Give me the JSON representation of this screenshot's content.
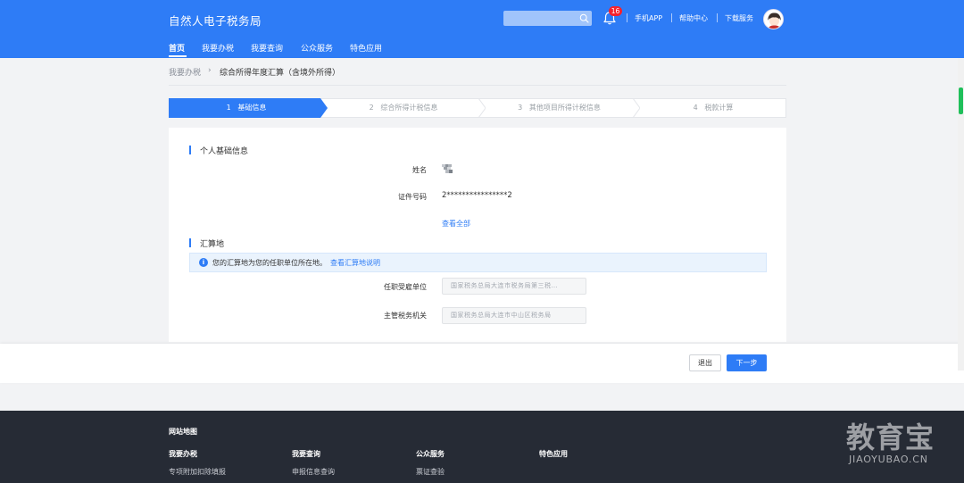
{
  "header": {
    "site_title": "自然人电子税务局",
    "search_placeholder": "",
    "notification_count": "16",
    "links": [
      "手机APP",
      "帮助中心",
      "下载服务"
    ]
  },
  "nav": {
    "items": [
      "首页",
      "我要办税",
      "我要查询",
      "公众服务",
      "特色应用"
    ],
    "active_index": 0
  },
  "breadcrumb": {
    "parent": "我要办税",
    "separator": "›",
    "current": "综合所得年度汇算（含境外所得）"
  },
  "steps": [
    {
      "number": "1",
      "label": "基础信息",
      "active": true
    },
    {
      "number": "2",
      "label": "综合所得计税信息",
      "active": false
    },
    {
      "number": "3",
      "label": "其他项目所得计税信息",
      "active": false
    },
    {
      "number": "4",
      "label": "税款计算",
      "active": false
    }
  ],
  "personal_info": {
    "section_title": "个人基础信息",
    "name_label": "姓名",
    "id_label": "证件号码",
    "id_value": "2****************2",
    "view_all_link": "查看全部"
  },
  "settlement": {
    "section_title": "汇算地",
    "notice_text": "您的汇算地为您的任职单位所在地。",
    "notice_link": "查看汇算地说明",
    "employer_label": "任职受雇单位",
    "employer_value": "国家税务总局大连市税务局第三税…",
    "tax_office_label": "主管税务机关",
    "tax_office_value": "国家税务总局大连市中山区税务局"
  },
  "actions": {
    "exit_label": "退出",
    "next_label": "下一步"
  },
  "footer": {
    "title": "网站地图",
    "columns": [
      {
        "heading": "我要办税",
        "link": "专项附加扣除填报"
      },
      {
        "heading": "我要查询",
        "link": "申报信息查询"
      },
      {
        "heading": "公众服务",
        "link": "票证查验"
      },
      {
        "heading": "特色应用",
        "link": ""
      }
    ]
  },
  "watermark": {
    "cn": "教育宝",
    "en": "JIAOYUBAO.CN"
  },
  "colors": {
    "primary": "#2e7cf6",
    "badge": "#f5222d",
    "footer_bg": "#262b35"
  }
}
